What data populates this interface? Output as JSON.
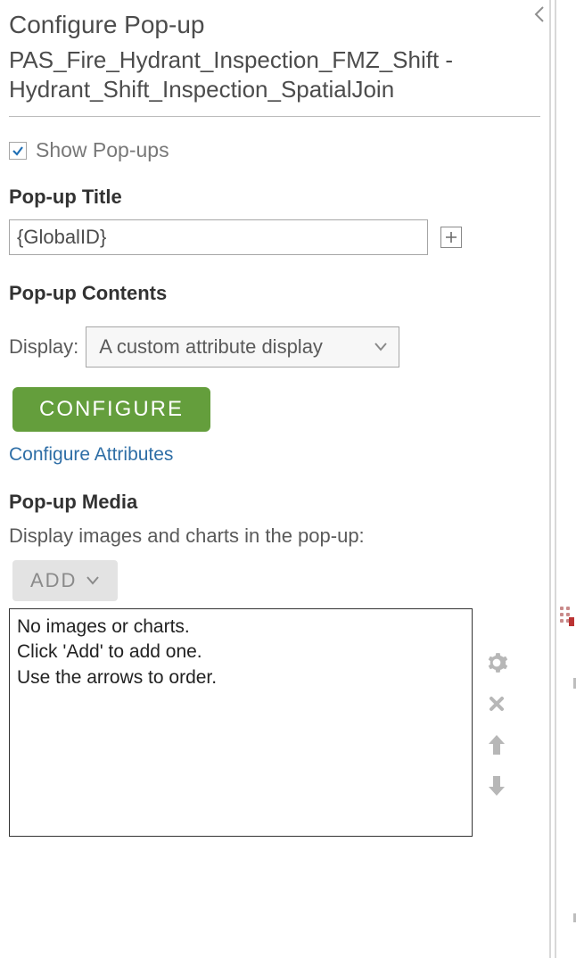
{
  "header": {
    "title": "Configure Pop-up",
    "subtitle": "PAS_Fire_Hydrant_Inspection_FMZ_Shift - Hydrant_Shift_Inspection_SpatialJoin"
  },
  "showPopups": {
    "checked": true,
    "label": "Show Pop-ups"
  },
  "popupTitle": {
    "label": "Pop-up Title",
    "value": "{GlobalID}"
  },
  "popupContents": {
    "label": "Pop-up Contents",
    "displayLabel": "Display:",
    "displayValue": "A custom attribute display",
    "configureLabel": "CONFIGURE",
    "configureAttributesLink": "Configure Attributes"
  },
  "popupMedia": {
    "label": "Pop-up Media",
    "description": "Display images and charts in the pop-up:",
    "addLabel": "ADD",
    "emptyLine1": "No images or charts.",
    "emptyLine2": "Click 'Add' to add one.",
    "emptyLine3": "Use the arrows to order."
  }
}
